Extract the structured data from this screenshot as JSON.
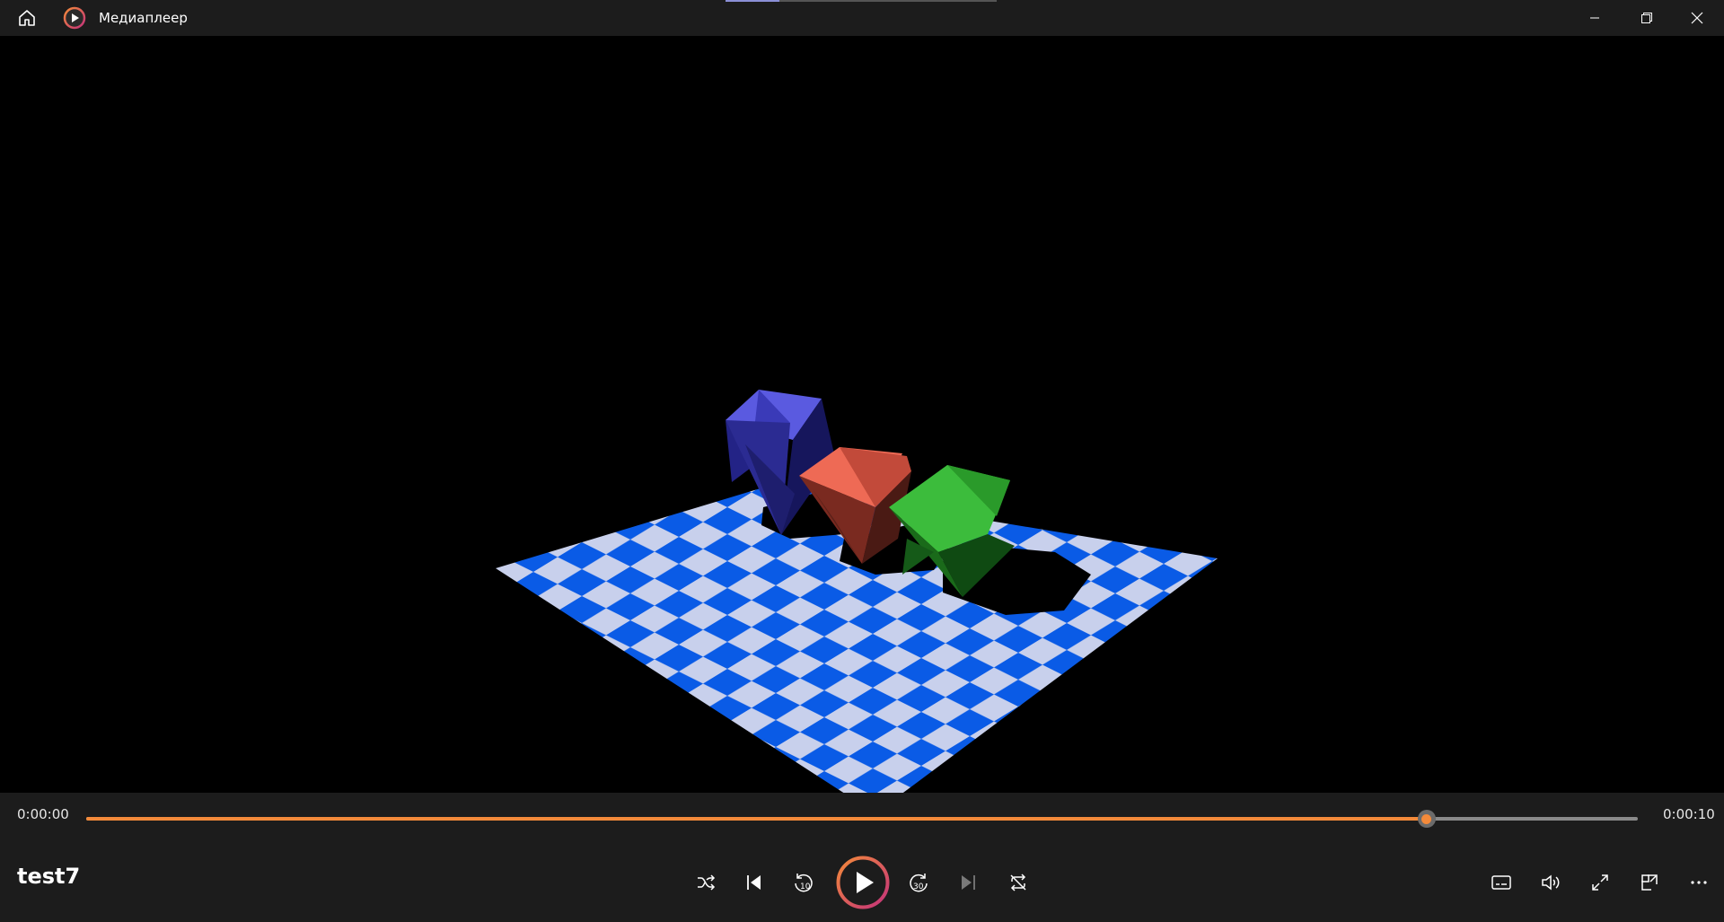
{
  "window": {
    "app_title": "Медиаплеер",
    "icons": [
      "home-icon",
      "media-player-app-icon",
      "minimize-icon",
      "maximize-icon",
      "close-icon"
    ]
  },
  "player": {
    "media_title": "test7",
    "current_time": "0:00:00",
    "total_time": "0:00:10",
    "progress_fraction": 0.864,
    "accent_color": "#f38a3a"
  },
  "controls": {
    "center_icons": [
      "shuffle-icon",
      "previous-icon",
      "rewind-10-icon",
      "play-icon",
      "forward-30-icon",
      "next-icon",
      "repeat-icon"
    ],
    "rewind_seconds": "10",
    "forward_seconds": "30",
    "right_icons": [
      "subtitles-icon",
      "volume-icon",
      "fullscreen-icon",
      "mini-player-icon",
      "more-options-icon"
    ]
  },
  "video_scene": {
    "description_colors": {
      "floor_blue": "#0a5be6",
      "floor_light": "#c8d0ec",
      "blue_shape": "#5a5ae0",
      "red_shape": "#ee6a55",
      "green_shape": "#3cbc3c"
    }
  }
}
